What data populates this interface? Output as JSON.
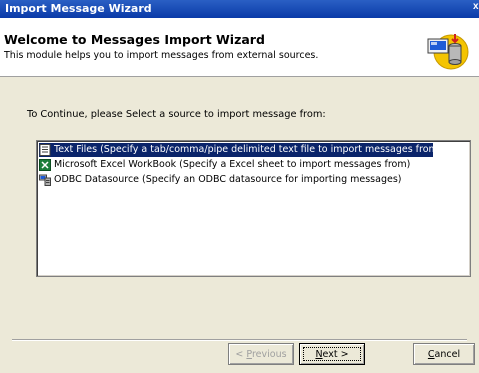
{
  "window": {
    "title": "Import Message Wizard",
    "close_glyph": "x"
  },
  "header": {
    "title": "Welcome to Messages Import Wizard",
    "subtitle": "This module helps you to import messages from external sources.",
    "icon": "database-import-icon"
  },
  "prompt": "To Continue, please Select a source to import message from:",
  "sources": [
    {
      "label": "Text Files (Specify a tab/comma/pipe delimited text file to import messages from)",
      "icon": "text-file-icon",
      "selected": true
    },
    {
      "label": "Microsoft Excel WorkBook (Specify a Excel sheet to import messages from)",
      "icon": "excel-icon",
      "selected": false
    },
    {
      "label": "ODBC Datasource (Specify an ODBC datasource for importing messages)",
      "icon": "odbc-datasource-icon",
      "selected": false
    }
  ],
  "buttons": {
    "back_prefix": "< ",
    "back_key": "P",
    "back_rest": "revious",
    "next_key": "N",
    "next_rest": "ext >",
    "cancel_key": "C",
    "cancel_rest": "ancel"
  },
  "colors": {
    "selection": "#0a246a",
    "titlebar": "#0a3aa8",
    "dialog": "#ece9d8"
  }
}
